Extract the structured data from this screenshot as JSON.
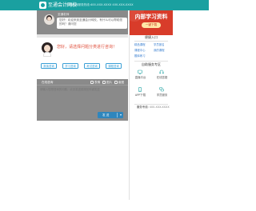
{
  "header": {
    "brand": "至通会计网校",
    "contact": "全国咨询服务热线:400-XXX-XXXX 400-XXX-XXXX"
  },
  "chat": {
    "agent_name": "至通老师",
    "welcome_message": "您好！欢迎来到至通会计网校，有什么可以帮助您的吗？请问您",
    "greeting": "您好，请选择问题分类进行咨询！",
    "quick_buttons": [
      "报读咨询",
      "学习咨询",
      "考试咨询",
      "课程咨询"
    ]
  },
  "input": {
    "toolbar_label": "在线咨询",
    "emoji_label": "表情",
    "file_label": "图片",
    "screenshot_label": "截图",
    "placeholder": "请输入您想咨询的问题，点击发送或按回车键发送",
    "send_label": "发 送"
  },
  "sidebar": {
    "promo_title": "内部学习资料",
    "promo_button": "一键下载",
    "quick_title": "便捷入口",
    "quick_links": [
      "精品课程",
      "学员报名",
      "课程中心",
      "我的课程",
      "题库练习"
    ],
    "service_title": "自助服务专区",
    "services": [
      {
        "label": "直播平台",
        "icon": "monitor-icon"
      },
      {
        "label": "在线答疑",
        "icon": "headset-icon"
      },
      {
        "label": "APP下载",
        "icon": "phone-icon"
      },
      {
        "label": "学员服务",
        "icon": "chat-bubbles-icon"
      }
    ],
    "hotline_label": "服务专线:",
    "hotline_number": "400-XXX-XXXX"
  },
  "colors": {
    "header": "#1aa0a0",
    "accent_red": "#d83c2a",
    "link_blue": "#3a7fd0",
    "send_blue": "#2f86bd"
  }
}
